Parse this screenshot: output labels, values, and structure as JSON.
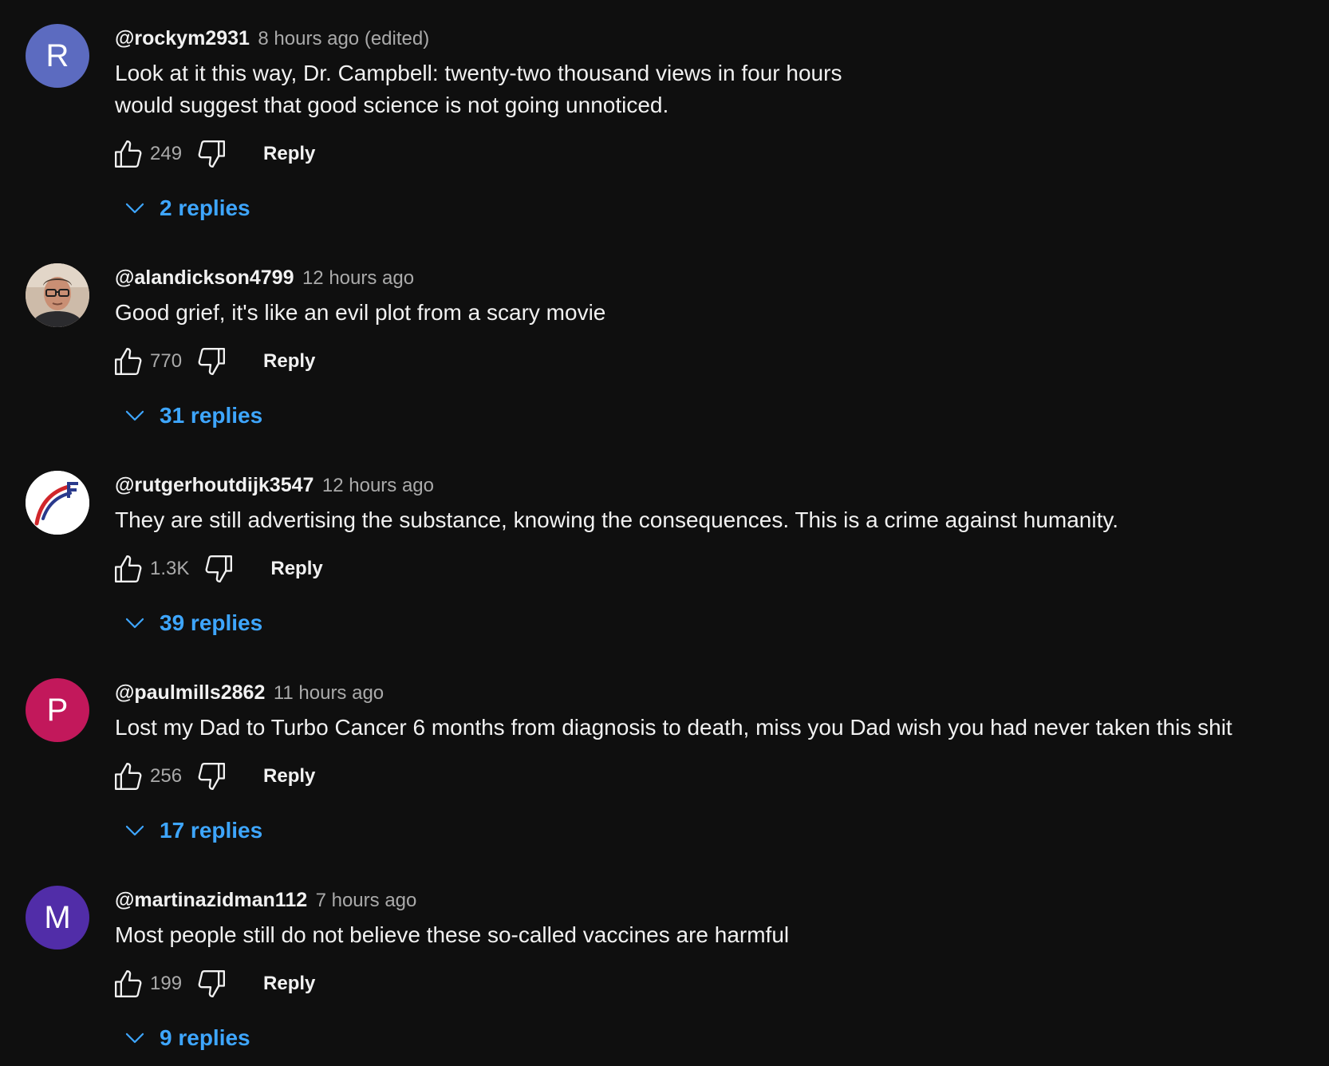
{
  "colors": {
    "background": "#0f0f0f",
    "text_primary": "#f1f1f1",
    "text_secondary": "#aaaaaa",
    "link_blue": "#3ea6ff"
  },
  "comments": [
    {
      "avatar": {
        "type": "letter",
        "letter": "R",
        "color": "#5c6bc0"
      },
      "author": "@rockym2931",
      "time": "8 hours ago (edited)",
      "text": "Look at it this way, Dr. Campbell:  twenty-two thousand views in four hours\nwould suggest that good science is not going unnoticed.",
      "likes": "249",
      "reply_label": "Reply",
      "replies_label": "2 replies"
    },
    {
      "avatar": {
        "type": "photo",
        "icon": "person-photo-avatar"
      },
      "author": "@alandickson4799",
      "time": "12 hours ago",
      "text": "Good grief, it's like an evil plot from a scary movie",
      "likes": "770",
      "reply_label": "Reply",
      "replies_label": "31 replies"
    },
    {
      "avatar": {
        "type": "logo",
        "icon": "arrow-logo-avatar"
      },
      "author": "@rutgerhoutdijk3547",
      "time": "12 hours ago",
      "text": "They are still advertising the substance, knowing the consequences. This is a crime against humanity.",
      "likes": "1.3K",
      "reply_label": "Reply",
      "replies_label": "39 replies"
    },
    {
      "avatar": {
        "type": "letter",
        "letter": "P",
        "color": "#c2185b"
      },
      "author": "@paulmills2862",
      "time": "11 hours ago",
      "text": "Lost my Dad to Turbo Cancer 6 months from diagnosis to death, miss you Dad wish you had never taken this shit",
      "likes": "256",
      "reply_label": "Reply",
      "replies_label": "17 replies"
    },
    {
      "avatar": {
        "type": "letter",
        "letter": "M",
        "color": "#512da8"
      },
      "author": "@martinazidman112",
      "time": "7 hours ago",
      "text": "Most people still do not believe these so-called vaccines are harmful",
      "likes": "199",
      "reply_label": "Reply",
      "replies_label": "9 replies"
    }
  ]
}
